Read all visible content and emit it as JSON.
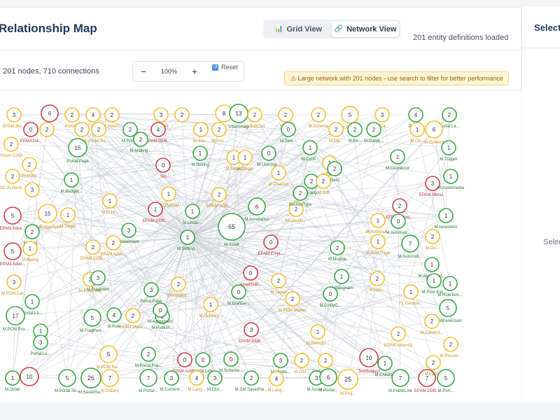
{
  "header": {
    "title": "Relationship Map",
    "grid_view_label": "Grid View",
    "network_view_label": "Network View",
    "entity_status": "201 entity definitions loaded"
  },
  "toolbar": {
    "stats": ": 201 nodes, 710 connections",
    "zoom_minus": "−",
    "zoom_level": "100%",
    "zoom_plus": "+",
    "reset_label": "Reset",
    "warning": "⚠ Large network with 201 nodes - use search to filter for better performance"
  },
  "side": {
    "title": "Select",
    "text": "Selec"
  },
  "icons": {
    "grid": "bar-chart-icon",
    "network": "link-icon",
    "reset": "reset-icon",
    "warning": "warning-icon"
  },
  "colors": {
    "green": "#3aa64a",
    "yellow": "#f2c230",
    "red": "#d33c4d",
    "green_label": "#2b7a36",
    "yellow_label": "#c9911a",
    "red_label": "#c0303f",
    "edge": "#c7ccd4"
  },
  "nodes": [
    {
      "v": "3",
      "c": "y",
      "l": "EPAM.Blu..."
    },
    {
      "v": "6",
      "c": "r",
      "l": ""
    },
    {
      "v": "2",
      "c": "y",
      "l": "Portal..."
    },
    {
      "v": "4",
      "c": "y",
      "l": "M.Video"
    },
    {
      "v": "2",
      "c": "y",
      "l": "M.Video..."
    },
    {
      "v": "3",
      "c": "y",
      "l": "M.Asset"
    },
    {
      "v": "2",
      "c": "y",
      "l": ""
    },
    {
      "v": "8",
      "c": "y",
      "l": ""
    },
    {
      "v": "13",
      "c": "g",
      "l": "UserGroup"
    },
    {
      "v": "2",
      "c": "y",
      "l": "M.SubCon"
    },
    {
      "v": "2",
      "c": "y",
      "l": "M.File"
    },
    {
      "v": "2",
      "c": "y",
      "l": "M.Scheme"
    },
    {
      "v": "5",
      "c": "y",
      "l": "M.Project"
    },
    {
      "v": "3",
      "c": "y",
      "l": "M.Ca..."
    },
    {
      "v": "4",
      "c": "g",
      "l": "Portal..."
    },
    {
      "v": "2",
      "c": "g",
      "l": "Portal.La..."
    },
    {
      "v": "0",
      "c": "r",
      "l": "EPAM.Da..."
    },
    {
      "v": "2",
      "c": "y",
      "l": ""
    },
    {
      "v": "2",
      "c": "y",
      "l": "M.Sub..."
    },
    {
      "v": "2",
      "c": "y",
      "l": "Portal.Pa..."
    },
    {
      "v": "2",
      "c": "g",
      "l": "M.Print..."
    },
    {
      "v": "4",
      "c": "r",
      "l": "EPAM.DDB..."
    },
    {
      "v": "1",
      "c": "y",
      "l": "M.Ass..."
    },
    {
      "v": "2",
      "c": "y",
      "l": "M.Ass..."
    },
    {
      "v": "0",
      "c": "g",
      "l": "M.Sele..."
    },
    {
      "v": "2",
      "c": "y",
      "l": "M.Op..."
    },
    {
      "v": "2",
      "c": "g",
      "l": "M.Ex..."
    },
    {
      "v": "2",
      "c": "g",
      "l": "M.Datab..."
    },
    {
      "v": "1",
      "c": "y",
      "l": "M.Co..."
    },
    {
      "v": "6",
      "c": "y",
      "l": "M.Content"
    },
    {
      "v": "1",
      "c": "g",
      "l": "M.Trigger"
    },
    {
      "v": "15",
      "c": "g",
      "l": "Portal.Page"
    },
    {
      "v": "2",
      "c": "g",
      "l": "M.Mailing..."
    },
    {
      "v": "1",
      "c": "g",
      "l": "M.Setting"
    },
    {
      "v": "2",
      "c": "y",
      "l": "Vision.Color"
    },
    {
      "v": "1",
      "c": "y",
      "l": "M.Target"
    },
    {
      "v": "1",
      "c": "y",
      "l": "M.Target"
    },
    {
      "v": "0",
      "c": "g",
      "l": "M.UserAgr..."
    },
    {
      "v": "1",
      "c": "g",
      "l": "M.Confi..."
    },
    {
      "v": "1",
      "c": "g",
      "l": "M.Connector"
    },
    {
      "v": "0",
      "c": "r",
      "l": "Yes"
    },
    {
      "v": "2",
      "c": "y",
      "l": "EPAM.Bd..."
    },
    {
      "v": "1",
      "c": "y",
      "l": "M.Export"
    },
    {
      "v": "1",
      "c": "y",
      "l": "M.Channel"
    },
    {
      "v": "2",
      "c": "g",
      "l": "M.Desc..."
    },
    {
      "v": "1",
      "c": "g",
      "l": "M.Budget..."
    },
    {
      "v": "2",
      "c": "y",
      "l": "SC.Al.Gene..."
    },
    {
      "v": "2",
      "c": "g",
      "l": "M.Lang..."
    },
    {
      "v": "3",
      "c": "r",
      "l": "EPAM.Menu..."
    },
    {
      "v": "3",
      "c": "y",
      "l": ""
    },
    {
      "v": "1",
      "c": "y",
      "l": "M.Channel"
    },
    {
      "v": "2",
      "c": "y",
      "l": "EPAM.DDB..."
    },
    {
      "v": "2",
      "c": "y",
      "l": "M.Job"
    },
    {
      "v": "1",
      "c": "g",
      "l": "M.Assetmedia"
    },
    {
      "v": "2",
      "c": "r",
      "l": "EPAM.Menu..."
    },
    {
      "v": "1",
      "c": "y",
      "l": "M.Print..."
    },
    {
      "v": "6",
      "c": "g",
      "l": "M.Annotation"
    },
    {
      "v": "2",
      "c": "y",
      "l": "M.Localiz..."
    },
    {
      "v": "2",
      "c": "g",
      "l": "SectionType"
    },
    {
      "v": "5",
      "c": "r",
      "l": "EPAM.Adve..."
    },
    {
      "v": "15",
      "c": "y",
      "l": "M.BudgetType"
    },
    {
      "v": "1",
      "c": "y",
      "l": "M.Target"
    },
    {
      "v": "1",
      "c": "r",
      "l": "EPAM.DDB..."
    },
    {
      "v": "1",
      "c": "g",
      "l": "M.Locali..."
    },
    {
      "v": "1",
      "c": "y",
      "l": "M.Automati..."
    },
    {
      "v": "0",
      "c": "g",
      "l": "M.Automati..."
    },
    {
      "v": "1",
      "c": "g",
      "l": "M.Newsitem"
    },
    {
      "v": "2",
      "c": "g",
      "l": "M.Lang..."
    },
    {
      "v": "3",
      "c": "g",
      "l": "Watermark"
    },
    {
      "v": "1",
      "c": "g",
      "l": "M.Setting..."
    },
    {
      "v": "65",
      "c": "g",
      "l": "M.Asset"
    },
    {
      "v": "0",
      "c": "r",
      "l": "EPAM.Empl..."
    },
    {
      "v": "2",
      "c": "g",
      "l": "M.Module"
    },
    {
      "v": "1",
      "c": "y",
      "l": "M.Print.Page"
    },
    {
      "v": "7",
      "c": "g",
      "l": "M.Automati..."
    },
    {
      "v": "2",
      "c": "y",
      "l": "M.Ge..."
    },
    {
      "v": "5",
      "c": "r",
      "l": "EPAM.Adve..."
    },
    {
      "v": "1",
      "c": "y",
      "l": "M.Rating"
    },
    {
      "v": "2",
      "c": "y",
      "l": "EPAM.DDB..."
    },
    {
      "v": "2",
      "c": "y",
      "l": "EPAM.Adve..."
    },
    {
      "v": "3",
      "c": "y",
      "l": "M.Fragment"
    },
    {
      "v": "1",
      "c": "g",
      "l": "M.AgentMed..."
    },
    {
      "v": "1",
      "c": "g",
      "l": "M.Print.Ent..."
    },
    {
      "v": "3",
      "c": "g",
      "l": "M.Fragment"
    },
    {
      "v": "0",
      "c": "r",
      "l": "AssetStat..."
    },
    {
      "v": "2",
      "c": "y",
      "l": "M.Tagret"
    },
    {
      "v": "1",
      "c": "g",
      "l": "M.Geograph"
    },
    {
      "v": "2",
      "c": "y",
      "l": "M.Geo..."
    },
    {
      "v": "3",
      "c": "y",
      "l": "M.PCM.Cat..."
    },
    {
      "v": "1",
      "c": "g",
      "l": "Portal.La..."
    },
    {
      "v": "3",
      "c": "g",
      "l": "Portal.Page"
    },
    {
      "v": "2",
      "c": "y",
      "l": "EPAM.Pro..."
    },
    {
      "v": "0",
      "c": "g",
      "l": "M.DraftDe..."
    },
    {
      "v": "2",
      "c": "y",
      "l": "M.PCM.Market"
    },
    {
      "v": "0",
      "c": "g",
      "l": "M.EntityC..."
    },
    {
      "v": "1",
      "c": "g",
      "l": "M.RoleTem..."
    },
    {
      "v": "1",
      "c": "y",
      "l": "FL.Geogra..."
    },
    {
      "v": "17",
      "c": "g",
      "l": "M.PCM.Pro..."
    },
    {
      "v": "1",
      "c": "g",
      "l": "Market"
    },
    {
      "v": "5",
      "c": "g",
      "l": "M.Fragmen..."
    },
    {
      "v": "4",
      "c": "g",
      "l": "M.Role"
    },
    {
      "v": "2",
      "c": "y",
      "l": "EPAM.Menu..."
    },
    {
      "v": "1",
      "c": "g",
      "l": "M.Publish..."
    },
    {
      "v": "1",
      "c": "y",
      "l": "M.Delivery..."
    },
    {
      "v": "5",
      "c": "g",
      "l": "M.WhereUsed"
    },
    {
      "v": "2",
      "c": "y",
      "l": "M.Content..."
    },
    {
      "v": "3",
      "c": "g",
      "l": "Portal.La..."
    },
    {
      "v": "0",
      "c": "g",
      "l": "M.Agreement"
    },
    {
      "v": "3",
      "c": "r",
      "l": "EPAM.DDB..."
    },
    {
      "v": "1",
      "c": "y",
      "l": "M.DemoLi..."
    },
    {
      "v": "2",
      "c": "y",
      "l": "EPAM.Amenity"
    },
    {
      "v": "2",
      "c": "y",
      "l": "M.Recom..."
    },
    {
      "v": "5",
      "c": "y",
      "l": "M.PCM.Re..."
    },
    {
      "v": "2",
      "c": "g",
      "l": "M.Portal.Fra..."
    },
    {
      "v": "0",
      "c": "r",
      "l": "EPAM.Amb..."
    },
    {
      "v": "0",
      "c": "g",
      "l": "Portal.Link"
    },
    {
      "v": "0",
      "c": "g",
      "l": "M.Scheme..."
    },
    {
      "v": "3",
      "c": "g",
      "l": "M.Media..."
    },
    {
      "v": "2",
      "c": "y",
      "l": "M.Chil..."
    },
    {
      "v": "2",
      "c": "y",
      "l": "M.SavedSe..."
    },
    {
      "v": "10",
      "c": "r",
      "l": "TestSubject"
    },
    {
      "v": "1",
      "c": "g",
      "l": "M.Children"
    },
    {
      "v": "1",
      "c": "g",
      "l": "M.Order"
    },
    {
      "v": "10",
      "c": "r",
      "l": ""
    },
    {
      "v": "5",
      "c": "g",
      "l": "M.Portal.Sit..."
    },
    {
      "v": "26",
      "c": "g",
      "l": "M.SavedSe..."
    },
    {
      "v": "7",
      "c": "y",
      "l": "M.Gallery"
    },
    {
      "v": "7",
      "c": "g",
      "l": "M.Portal..."
    },
    {
      "v": "3",
      "c": "g",
      "l": "M.Content..."
    },
    {
      "v": "4",
      "c": "y",
      "l": "M.Lang..."
    },
    {
      "v": "3",
      "c": "g",
      "l": "M.Chil..."
    },
    {
      "v": "2",
      "c": "g",
      "l": "M.SM.SavedSe..."
    },
    {
      "v": "4",
      "c": "y",
      "l": "M.Lang..."
    },
    {
      "v": "3",
      "c": "g",
      "l": "M.Asset..."
    },
    {
      "v": "25",
      "c": "y",
      "l": "M.Proj..."
    },
    {
      "v": "6",
      "c": "g",
      "l": "M.Portal..."
    },
    {
      "v": "7",
      "c": "g",
      "l": "M.PublicLink"
    },
    {
      "v": "7",
      "c": "r",
      "l": "EPAM.DDB..."
    },
    {
      "v": "5",
      "c": "g",
      "l": "M.Port..."
    },
    {
      "v": "2",
      "c": "y",
      "l": "M.Lang..."
    }
  ]
}
